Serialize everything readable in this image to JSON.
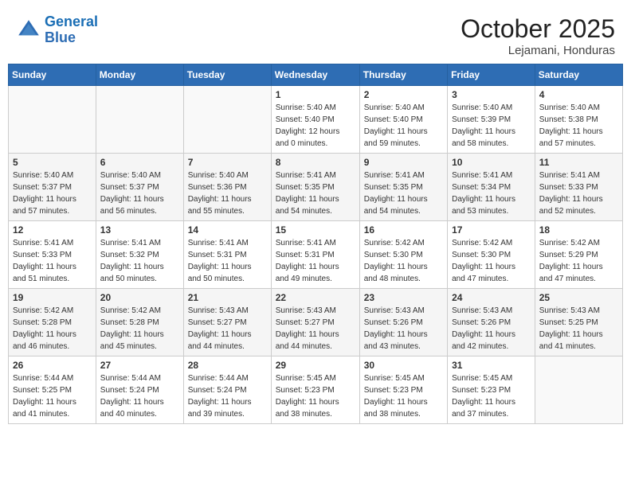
{
  "header": {
    "logo_line1": "General",
    "logo_line2": "Blue",
    "month": "October 2025",
    "location": "Lejamani, Honduras"
  },
  "weekdays": [
    "Sunday",
    "Monday",
    "Tuesday",
    "Wednesday",
    "Thursday",
    "Friday",
    "Saturday"
  ],
  "weeks": [
    [
      {
        "day": "",
        "info": ""
      },
      {
        "day": "",
        "info": ""
      },
      {
        "day": "",
        "info": ""
      },
      {
        "day": "1",
        "info": "Sunrise: 5:40 AM\nSunset: 5:40 PM\nDaylight: 12 hours\nand 0 minutes."
      },
      {
        "day": "2",
        "info": "Sunrise: 5:40 AM\nSunset: 5:40 PM\nDaylight: 11 hours\nand 59 minutes."
      },
      {
        "day": "3",
        "info": "Sunrise: 5:40 AM\nSunset: 5:39 PM\nDaylight: 11 hours\nand 58 minutes."
      },
      {
        "day": "4",
        "info": "Sunrise: 5:40 AM\nSunset: 5:38 PM\nDaylight: 11 hours\nand 57 minutes."
      }
    ],
    [
      {
        "day": "5",
        "info": "Sunrise: 5:40 AM\nSunset: 5:37 PM\nDaylight: 11 hours\nand 57 minutes."
      },
      {
        "day": "6",
        "info": "Sunrise: 5:40 AM\nSunset: 5:37 PM\nDaylight: 11 hours\nand 56 minutes."
      },
      {
        "day": "7",
        "info": "Sunrise: 5:40 AM\nSunset: 5:36 PM\nDaylight: 11 hours\nand 55 minutes."
      },
      {
        "day": "8",
        "info": "Sunrise: 5:41 AM\nSunset: 5:35 PM\nDaylight: 11 hours\nand 54 minutes."
      },
      {
        "day": "9",
        "info": "Sunrise: 5:41 AM\nSunset: 5:35 PM\nDaylight: 11 hours\nand 54 minutes."
      },
      {
        "day": "10",
        "info": "Sunrise: 5:41 AM\nSunset: 5:34 PM\nDaylight: 11 hours\nand 53 minutes."
      },
      {
        "day": "11",
        "info": "Sunrise: 5:41 AM\nSunset: 5:33 PM\nDaylight: 11 hours\nand 52 minutes."
      }
    ],
    [
      {
        "day": "12",
        "info": "Sunrise: 5:41 AM\nSunset: 5:33 PM\nDaylight: 11 hours\nand 51 minutes."
      },
      {
        "day": "13",
        "info": "Sunrise: 5:41 AM\nSunset: 5:32 PM\nDaylight: 11 hours\nand 50 minutes."
      },
      {
        "day": "14",
        "info": "Sunrise: 5:41 AM\nSunset: 5:31 PM\nDaylight: 11 hours\nand 50 minutes."
      },
      {
        "day": "15",
        "info": "Sunrise: 5:41 AM\nSunset: 5:31 PM\nDaylight: 11 hours\nand 49 minutes."
      },
      {
        "day": "16",
        "info": "Sunrise: 5:42 AM\nSunset: 5:30 PM\nDaylight: 11 hours\nand 48 minutes."
      },
      {
        "day": "17",
        "info": "Sunrise: 5:42 AM\nSunset: 5:30 PM\nDaylight: 11 hours\nand 47 minutes."
      },
      {
        "day": "18",
        "info": "Sunrise: 5:42 AM\nSunset: 5:29 PM\nDaylight: 11 hours\nand 47 minutes."
      }
    ],
    [
      {
        "day": "19",
        "info": "Sunrise: 5:42 AM\nSunset: 5:28 PM\nDaylight: 11 hours\nand 46 minutes."
      },
      {
        "day": "20",
        "info": "Sunrise: 5:42 AM\nSunset: 5:28 PM\nDaylight: 11 hours\nand 45 minutes."
      },
      {
        "day": "21",
        "info": "Sunrise: 5:43 AM\nSunset: 5:27 PM\nDaylight: 11 hours\nand 44 minutes."
      },
      {
        "day": "22",
        "info": "Sunrise: 5:43 AM\nSunset: 5:27 PM\nDaylight: 11 hours\nand 44 minutes."
      },
      {
        "day": "23",
        "info": "Sunrise: 5:43 AM\nSunset: 5:26 PM\nDaylight: 11 hours\nand 43 minutes."
      },
      {
        "day": "24",
        "info": "Sunrise: 5:43 AM\nSunset: 5:26 PM\nDaylight: 11 hours\nand 42 minutes."
      },
      {
        "day": "25",
        "info": "Sunrise: 5:43 AM\nSunset: 5:25 PM\nDaylight: 11 hours\nand 41 minutes."
      }
    ],
    [
      {
        "day": "26",
        "info": "Sunrise: 5:44 AM\nSunset: 5:25 PM\nDaylight: 11 hours\nand 41 minutes."
      },
      {
        "day": "27",
        "info": "Sunrise: 5:44 AM\nSunset: 5:24 PM\nDaylight: 11 hours\nand 40 minutes."
      },
      {
        "day": "28",
        "info": "Sunrise: 5:44 AM\nSunset: 5:24 PM\nDaylight: 11 hours\nand 39 minutes."
      },
      {
        "day": "29",
        "info": "Sunrise: 5:45 AM\nSunset: 5:23 PM\nDaylight: 11 hours\nand 38 minutes."
      },
      {
        "day": "30",
        "info": "Sunrise: 5:45 AM\nSunset: 5:23 PM\nDaylight: 11 hours\nand 38 minutes."
      },
      {
        "day": "31",
        "info": "Sunrise: 5:45 AM\nSunset: 5:23 PM\nDaylight: 11 hours\nand 37 minutes."
      },
      {
        "day": "",
        "info": ""
      }
    ]
  ]
}
